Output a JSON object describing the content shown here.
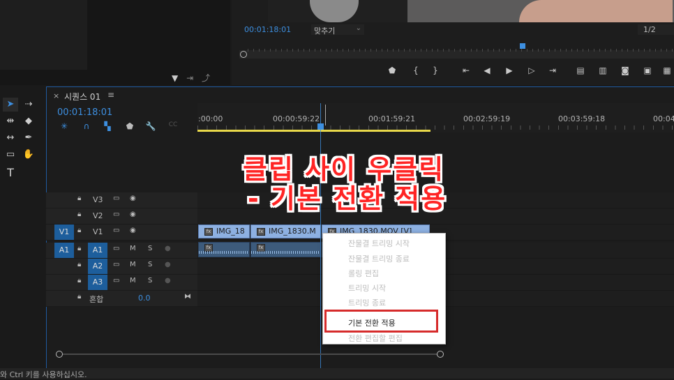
{
  "program_monitor": {
    "timecode": "00:01:18:01",
    "fit_option": "맞추기",
    "resolution": "1/2"
  },
  "timeline": {
    "tab_title": "시퀀스 01",
    "timecode": "00:01:18:01",
    "ruler_labels": [
      ":00:00",
      "00:00:59:22",
      "00:01:59:21",
      "00:02:59:19",
      "00:03:59:18",
      "00:04:"
    ],
    "tracks": {
      "v3": "V3",
      "v2": "V2",
      "v1_src": "V1",
      "v1": "V1",
      "a1_src": "A1",
      "a1": "A1",
      "a2": "A2",
      "a3": "A3",
      "mix_label": "혼합",
      "mix_value": "0.0",
      "mute": "M",
      "solo": "S"
    },
    "clips": [
      "IMG_18",
      "IMG_1830.M",
      "IMG_1830.MOV [V]"
    ],
    "fx_label": "fx"
  },
  "caption": {
    "line1": "클립 사이 우클릭",
    "line2": "- 기본 전환 적용"
  },
  "context_menu": {
    "items": [
      "잔물결 트리밍 시작",
      "잔물결 트리밍 종료",
      "롤링 편집",
      "트리밍 시작",
      "트리밍 종료",
      "기본 전환 적용",
      "전환 편집할 편집"
    ]
  },
  "status_bar": {
    "text": "와 Ctrl 키를 사용하십시오."
  },
  "colors": {
    "accent": "#3d8fe0",
    "clip_video": "#8db0e1",
    "clip_audio": "#3d5b7c",
    "highlight": "#d62b2b",
    "caption": "#ff2424"
  }
}
